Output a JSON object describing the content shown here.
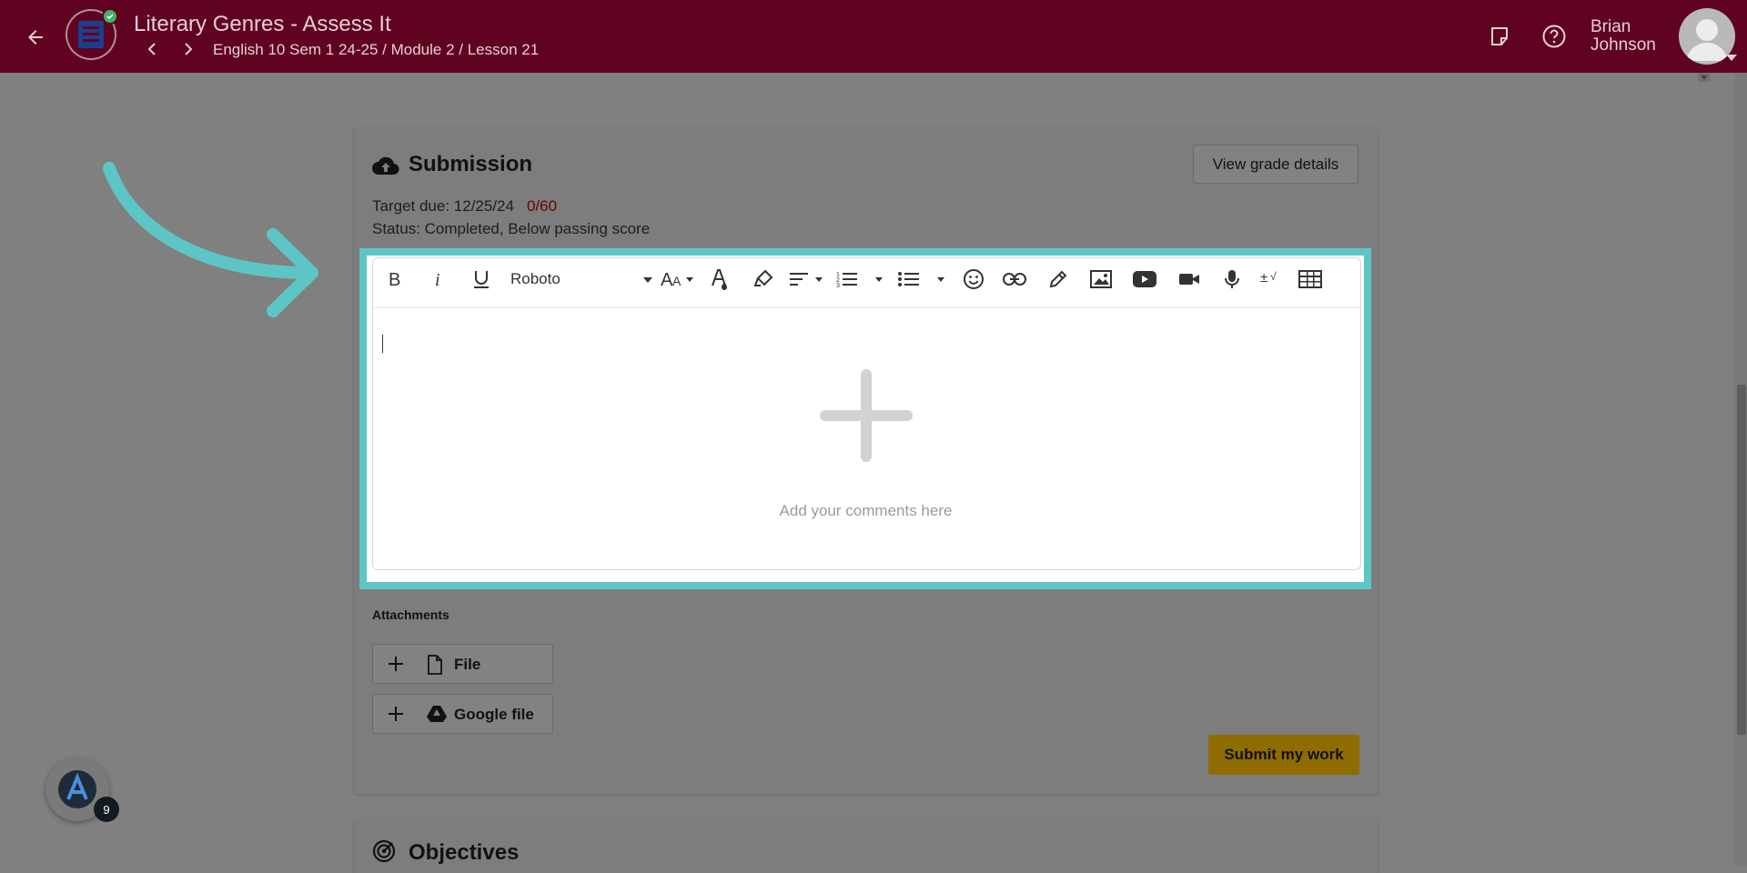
{
  "header": {
    "title": "Literary Genres - Assess It",
    "breadcrumb": "English 10 Sem 1 24-25 / Module 2 / Lesson 21",
    "user_first": "Brian",
    "user_last": "Johnson",
    "bg_color": "#5f0320"
  },
  "submission": {
    "title": "Submission",
    "view_grade_label": "View grade details",
    "target_due": "Target due: 12/25/24",
    "score": "0/60",
    "status": "Status: Completed, Below passing score"
  },
  "editor": {
    "font_name": "Roboto",
    "placeholder": "Add your comments here",
    "toolbar_icons": [
      "bold-icon",
      "italic-icon",
      "underline-icon",
      "font-select",
      "font-size-icon",
      "text-color-icon",
      "highlight-icon",
      "align-icon",
      "ordered-list-icon",
      "bullet-list-icon",
      "emoji-icon",
      "link-icon",
      "draw-icon",
      "image-icon",
      "youtube-icon",
      "video-icon",
      "mic-icon",
      "math-icon",
      "table-icon"
    ],
    "highlight_color": "#5ec5c7"
  },
  "attachments": {
    "label": "Attachments",
    "file_label": "File",
    "google_label": "Google file"
  },
  "actions": {
    "submit_label": "Submit my work",
    "submit_color": "#8f6c02"
  },
  "objectives": {
    "title": "Objectives"
  },
  "assistant": {
    "badge_count": "9"
  }
}
